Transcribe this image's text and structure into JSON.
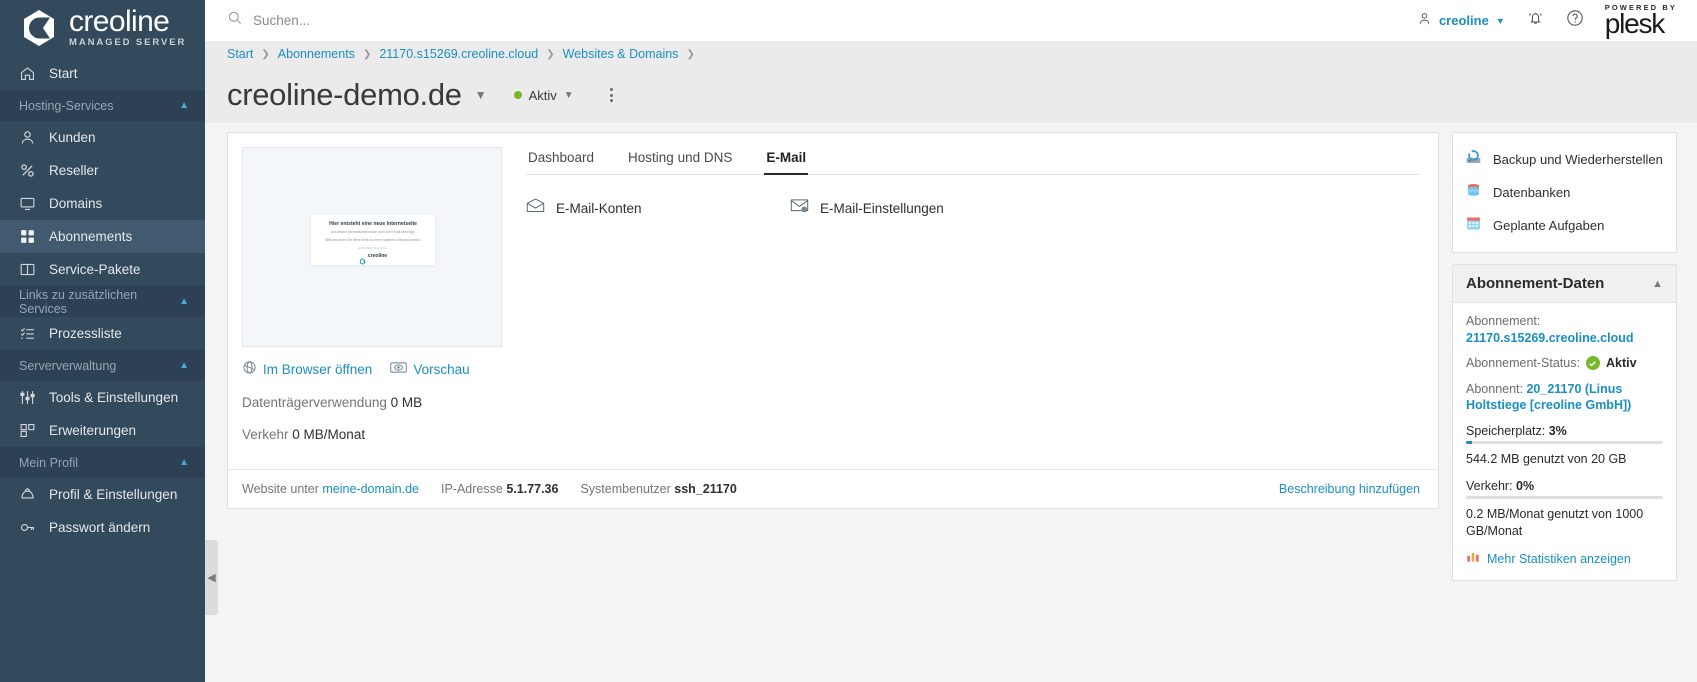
{
  "brand": {
    "logo_word": "creoline",
    "logo_sub": "MANAGED SERVER"
  },
  "sidebar": {
    "home": {
      "label": "Start",
      "icon": "home-icon"
    },
    "groups": [
      {
        "title": "Hosting-Services",
        "items": [
          {
            "label": "Kunden",
            "icon": "user-icon",
            "active": false
          },
          {
            "label": "Reseller",
            "icon": "percent-icon",
            "active": false
          },
          {
            "label": "Domains",
            "icon": "monitor-icon",
            "active": false
          },
          {
            "label": "Abonnements",
            "icon": "grid-icon",
            "active": true
          },
          {
            "label": "Service-Pakete",
            "icon": "book-icon",
            "active": false
          }
        ]
      },
      {
        "title": "Links zu zusätzlichen Services",
        "items": [
          {
            "label": "Prozessliste",
            "icon": "list-check-icon",
            "active": false
          }
        ]
      },
      {
        "title": "Serververwaltung",
        "items": [
          {
            "label": "Tools & Einstellungen",
            "icon": "sliders-icon",
            "active": false
          },
          {
            "label": "Erweiterungen",
            "icon": "extensions-icon",
            "active": false
          }
        ]
      },
      {
        "title": "Mein Profil",
        "items": [
          {
            "label": "Profil & Einstellungen",
            "icon": "profile-icon",
            "active": false
          },
          {
            "label": "Passwort ändern",
            "icon": "key-icon",
            "active": false
          }
        ]
      }
    ]
  },
  "header": {
    "search_placeholder": "Suchen...",
    "search_value": "",
    "user_name": "creoline",
    "powered_by": "POWERED BY",
    "plesk": "plesk"
  },
  "breadcrumb": [
    {
      "label": "Start"
    },
    {
      "label": "Abonnements"
    },
    {
      "label": "21170.s15269.creoline.cloud"
    },
    {
      "label": "Websites & Domains"
    }
  ],
  "page": {
    "title": "creoline-demo.de",
    "status": "Aktiv",
    "status_color": "#76b82a"
  },
  "main": {
    "tabs": [
      {
        "label": "Dashboard",
        "active": false
      },
      {
        "label": "Hosting und DNS",
        "active": false
      },
      {
        "label": "E-Mail",
        "active": true
      }
    ],
    "tools": [
      {
        "label": "E-Mail-Konten",
        "icon": "envelope-icon"
      },
      {
        "label": "E-Mail-Einstellungen",
        "icon": "envelope-gear-icon"
      }
    ],
    "thumbnail": {
      "heading": "Hier entsteht eine neue Internetseite",
      "paragraph1": "Auf diesem Internetauftritt wurde noch kein Inhalt hinterlegt.",
      "paragraph2": "Bitte besuchen Sie diese Seite zu einem späteren Zeitpunkt erneut.",
      "tiny": "EIN SERVICE VON",
      "brand": "creoline"
    },
    "links": [
      {
        "label": "Im Browser öffnen",
        "icon": "globe-icon"
      },
      {
        "label": "Vorschau",
        "icon": "eye-icon"
      }
    ],
    "stats": [
      {
        "label": "Datenträgerverwendung",
        "value": "0 MB"
      },
      {
        "label": "Verkehr",
        "value": "0 MB/Monat"
      }
    ],
    "footer": {
      "website_label": "Website unter",
      "website_value": "meine-domain.de",
      "ip_label": "IP-Adresse",
      "ip_value": "5.1.77.36",
      "sysuser_label": "Systembenutzer",
      "sysuser_value": "ssh_21170",
      "description_link": "Beschreibung hinzufügen"
    }
  },
  "rail": {
    "tools": [
      {
        "label": "Backup und Wiederherstellen",
        "icon": "backup-icon"
      },
      {
        "label": "Datenbanken",
        "icon": "database-icon"
      },
      {
        "label": "Geplante Aufgaben",
        "icon": "calendar-icon"
      }
    ],
    "panel": {
      "title": "Abonnement-Daten",
      "subscription_label": "Abonnement:",
      "subscription_value": "21170.s15269.creoline.cloud",
      "status_label": "Abonnement-Status:",
      "status_value": "Aktiv",
      "subscriber_label": "Abonnent:",
      "subscriber_value": "20_21170 (Linus Holtstiege [creoline GmbH])",
      "disk_label": "Speicherplatz:",
      "disk_percent": "3%",
      "disk_percent_num": 3,
      "disk_note": "544.2 MB genutzt von 20 GB",
      "traffic_label": "Verkehr:",
      "traffic_percent": "0%",
      "traffic_percent_num": 0,
      "traffic_note": "0.2 MB/Monat genutzt von 1000 GB/Monat",
      "stats_link": "Mehr Statistiken anzeigen"
    }
  }
}
